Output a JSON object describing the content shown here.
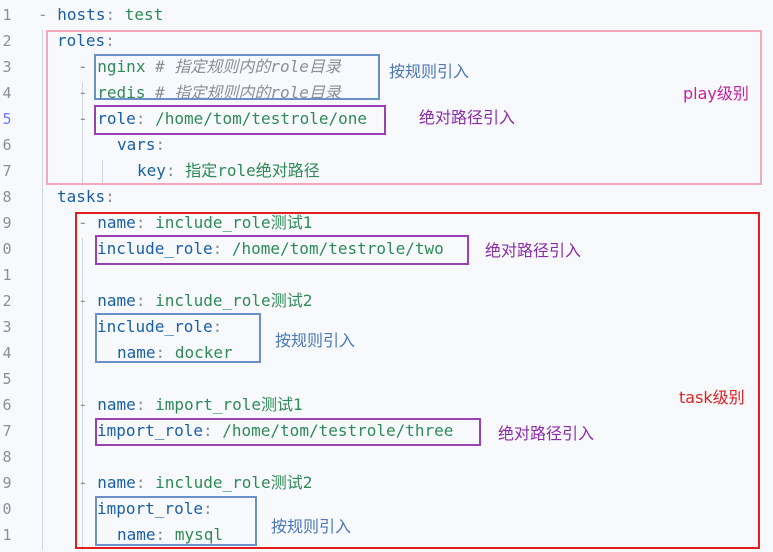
{
  "line_numbers": [
    "1",
    "2",
    "3",
    "4",
    "5",
    "6",
    "7",
    "8",
    "9",
    "0",
    "1",
    "2",
    "3",
    "4",
    "5",
    "6",
    "7",
    "8",
    "9",
    "0",
    "1"
  ],
  "active_line_index": 4,
  "lines": {
    "l1_dash": "-",
    "l1_key": "hosts",
    "l1_colon": ":",
    "l1_val": "test",
    "l2_key": "roles",
    "l2_colon": ":",
    "l3_dash": "-",
    "l3_val": "nginx",
    "l3_comment": "# 指定规则内的role目录",
    "l4_dash": "-",
    "l4_val": "redis",
    "l4_comment": "# 指定规则内的role目录",
    "l5_dash": "-",
    "l5_key": "role",
    "l5_colon": ":",
    "l5_val": "/home/tom/testrole/one",
    "l6_key": "vars",
    "l6_colon": ":",
    "l7_key": "key",
    "l7_colon": ":",
    "l7_val": "指定role绝对路径",
    "l8_key": "tasks",
    "l8_colon": ":",
    "l9_dash": "-",
    "l9_key": "name",
    "l9_colon": ":",
    "l9_val": "include_role测试1",
    "l10_key": "include_role",
    "l10_colon": ":",
    "l10_val": "/home/tom/testrole/two",
    "l12_dash": "-",
    "l12_key": "name",
    "l12_colon": ":",
    "l12_val": "include_role测试2",
    "l13_key": "include_role",
    "l13_colon": ":",
    "l14_key": "name",
    "l14_colon": ":",
    "l14_val": "docker",
    "l16_dash": "-",
    "l16_key": "name",
    "l16_colon": ":",
    "l16_val": "import_role测试1",
    "l17_key": "import_role",
    "l17_colon": ":",
    "l17_val": "/home/tom/testrole/three",
    "l19_dash": "-",
    "l19_key": "name",
    "l19_colon": ":",
    "l19_val": "include_role测试2",
    "l20_key": "import_role",
    "l20_colon": ":",
    "l21_key": "name",
    "l21_colon": ":",
    "l21_val": "mysql"
  },
  "annotations": {
    "rule_ref_1": "按规则引入",
    "abs_ref_1": "绝对路径引入",
    "play_level": "play级别",
    "abs_ref_2": "绝对路径引入",
    "rule_ref_2": "按规则引入",
    "task_level": "task级别",
    "abs_ref_3": "绝对路径引入",
    "rule_ref_3": "按规则引入"
  },
  "colors": {
    "key": "#1a5fa6",
    "value": "#2e8b57",
    "comment": "#8a8f98",
    "play_box": "#f4a9b8",
    "task_box": "#e02020",
    "rule_box": "#6b8fc7",
    "abs_box": "#9a40b5"
  }
}
